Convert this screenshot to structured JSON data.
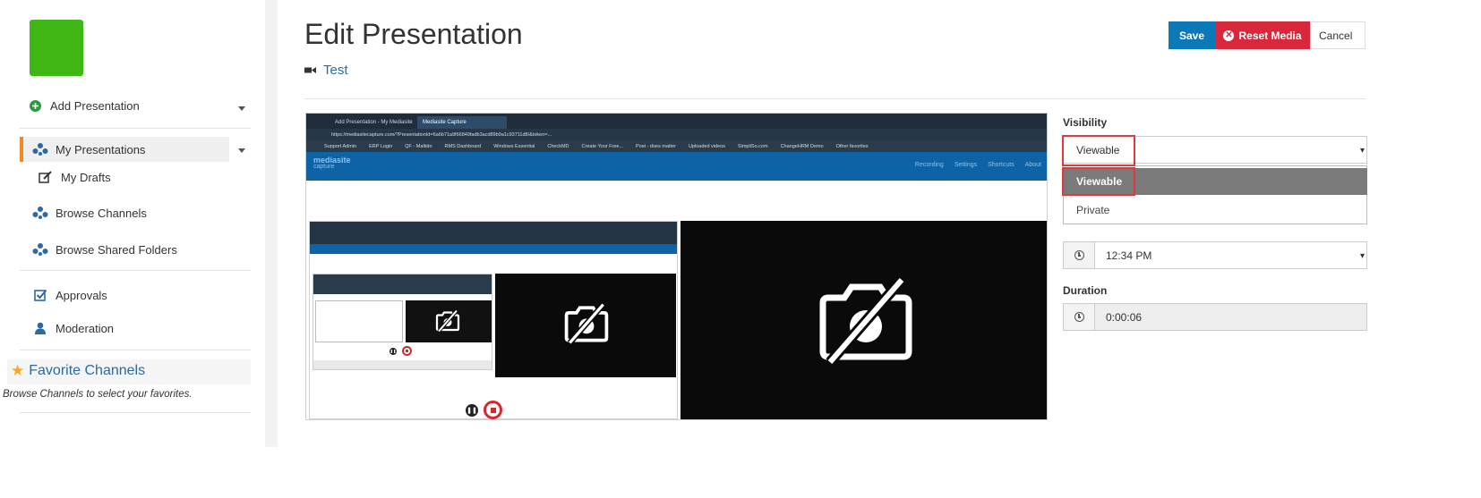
{
  "sidebar": {
    "add_presentation": "Add Presentation",
    "my_presentations": "My Presentations",
    "my_drafts": "My Drafts",
    "browse_channels": "Browse Channels",
    "browse_shared_folders": "Browse Shared Folders",
    "approvals": "Approvals",
    "moderation": "Moderation",
    "favorite_channels_title": "Favorite Channels",
    "favorite_channels_hint": "Browse Channels to select your favorites."
  },
  "header": {
    "title": "Edit Presentation",
    "subtitle": "Test",
    "save_label": "Save",
    "reset_label": "Reset Media",
    "cancel_label": "Cancel"
  },
  "preview": {
    "tab1": "Add Presentation - My Mediasite",
    "tab2": "Mediasite Capture",
    "url": "https://mediasitecapture.com/?PresentationId=6a6b71a9f66849fadb3acd89b9a1c93711d8/&token=...",
    "bookmarks": [
      "Support Admin",
      "ERP Login",
      "QF - Maltido",
      "RMS Dashboard",
      "Windows Essential",
      "CheckMD",
      "Create Your Free...",
      "Post - does matter",
      "Uploaded videos",
      "SimpliSo.com",
      "ChangeHRM Demo",
      "Other favorites"
    ],
    "brand": "mediasite",
    "brand_sub": "capture",
    "menu": [
      "Recording",
      "Settings",
      "Shortcuts",
      "About"
    ]
  },
  "form": {
    "visibility_label": "Visibility",
    "visibility_value": "Viewable",
    "visibility_options": [
      "Viewable",
      "Private"
    ],
    "time_value": "12:34 PM",
    "duration_label": "Duration",
    "duration_value": "0:00:06"
  },
  "colors": {
    "accent_blue": "#0b79b8",
    "reset_red": "#d9283b",
    "logo_green": "#3fb816",
    "active_orange": "#f08a24",
    "highlight_red": "#e03a3a"
  }
}
